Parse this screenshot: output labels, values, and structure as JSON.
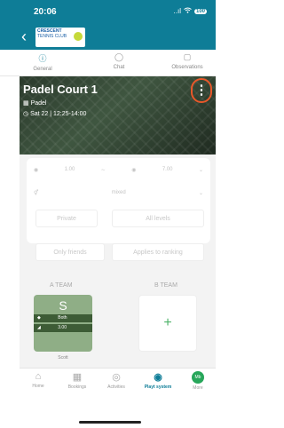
{
  "status": {
    "time": "20:06",
    "signal": "..ıl",
    "battery": "100"
  },
  "nav": {
    "back_icon": "chevron-left-icon",
    "logo_line1": "CRESCENT",
    "logo_line2": "TENNIS CLUB"
  },
  "tabs": [
    {
      "label": "General",
      "icon": "info-icon",
      "active": true
    },
    {
      "label": "Chat",
      "icon": "chat-icon"
    },
    {
      "label": "Observations",
      "icon": "notes-icon"
    }
  ],
  "hero": {
    "title": "Padel Court 1",
    "sport": "Padel",
    "when": "Sat 22 | 12:25-14:00",
    "menu_icon": "more-vertical-icon"
  },
  "filters": {
    "level_min": "1.00",
    "level_max": "7.00",
    "gender": "mixed",
    "visibility": "Private",
    "levels": "All levels",
    "audience": "Only friends",
    "ranking": "Applies to ranking"
  },
  "teams": {
    "a_label": "A TEAM",
    "b_label": "B TEAM",
    "player": {
      "initial": "S",
      "side": "Both",
      "level": "3.00",
      "name": "Scott"
    },
    "add_symbol": "+"
  },
  "tabbar": [
    {
      "label": "Home",
      "icon": "home-icon"
    },
    {
      "label": "Bookings",
      "icon": "calendar-icon"
    },
    {
      "label": "Activities",
      "icon": "chat-bubbles-icon"
    },
    {
      "label": "Playt system",
      "icon": "tennis-ball-icon",
      "active": true
    },
    {
      "label": "More",
      "avatar": "Mb"
    }
  ],
  "colors": {
    "primary": "#0e7d97",
    "accent": "#e8582a",
    "green": "#27a65a"
  }
}
